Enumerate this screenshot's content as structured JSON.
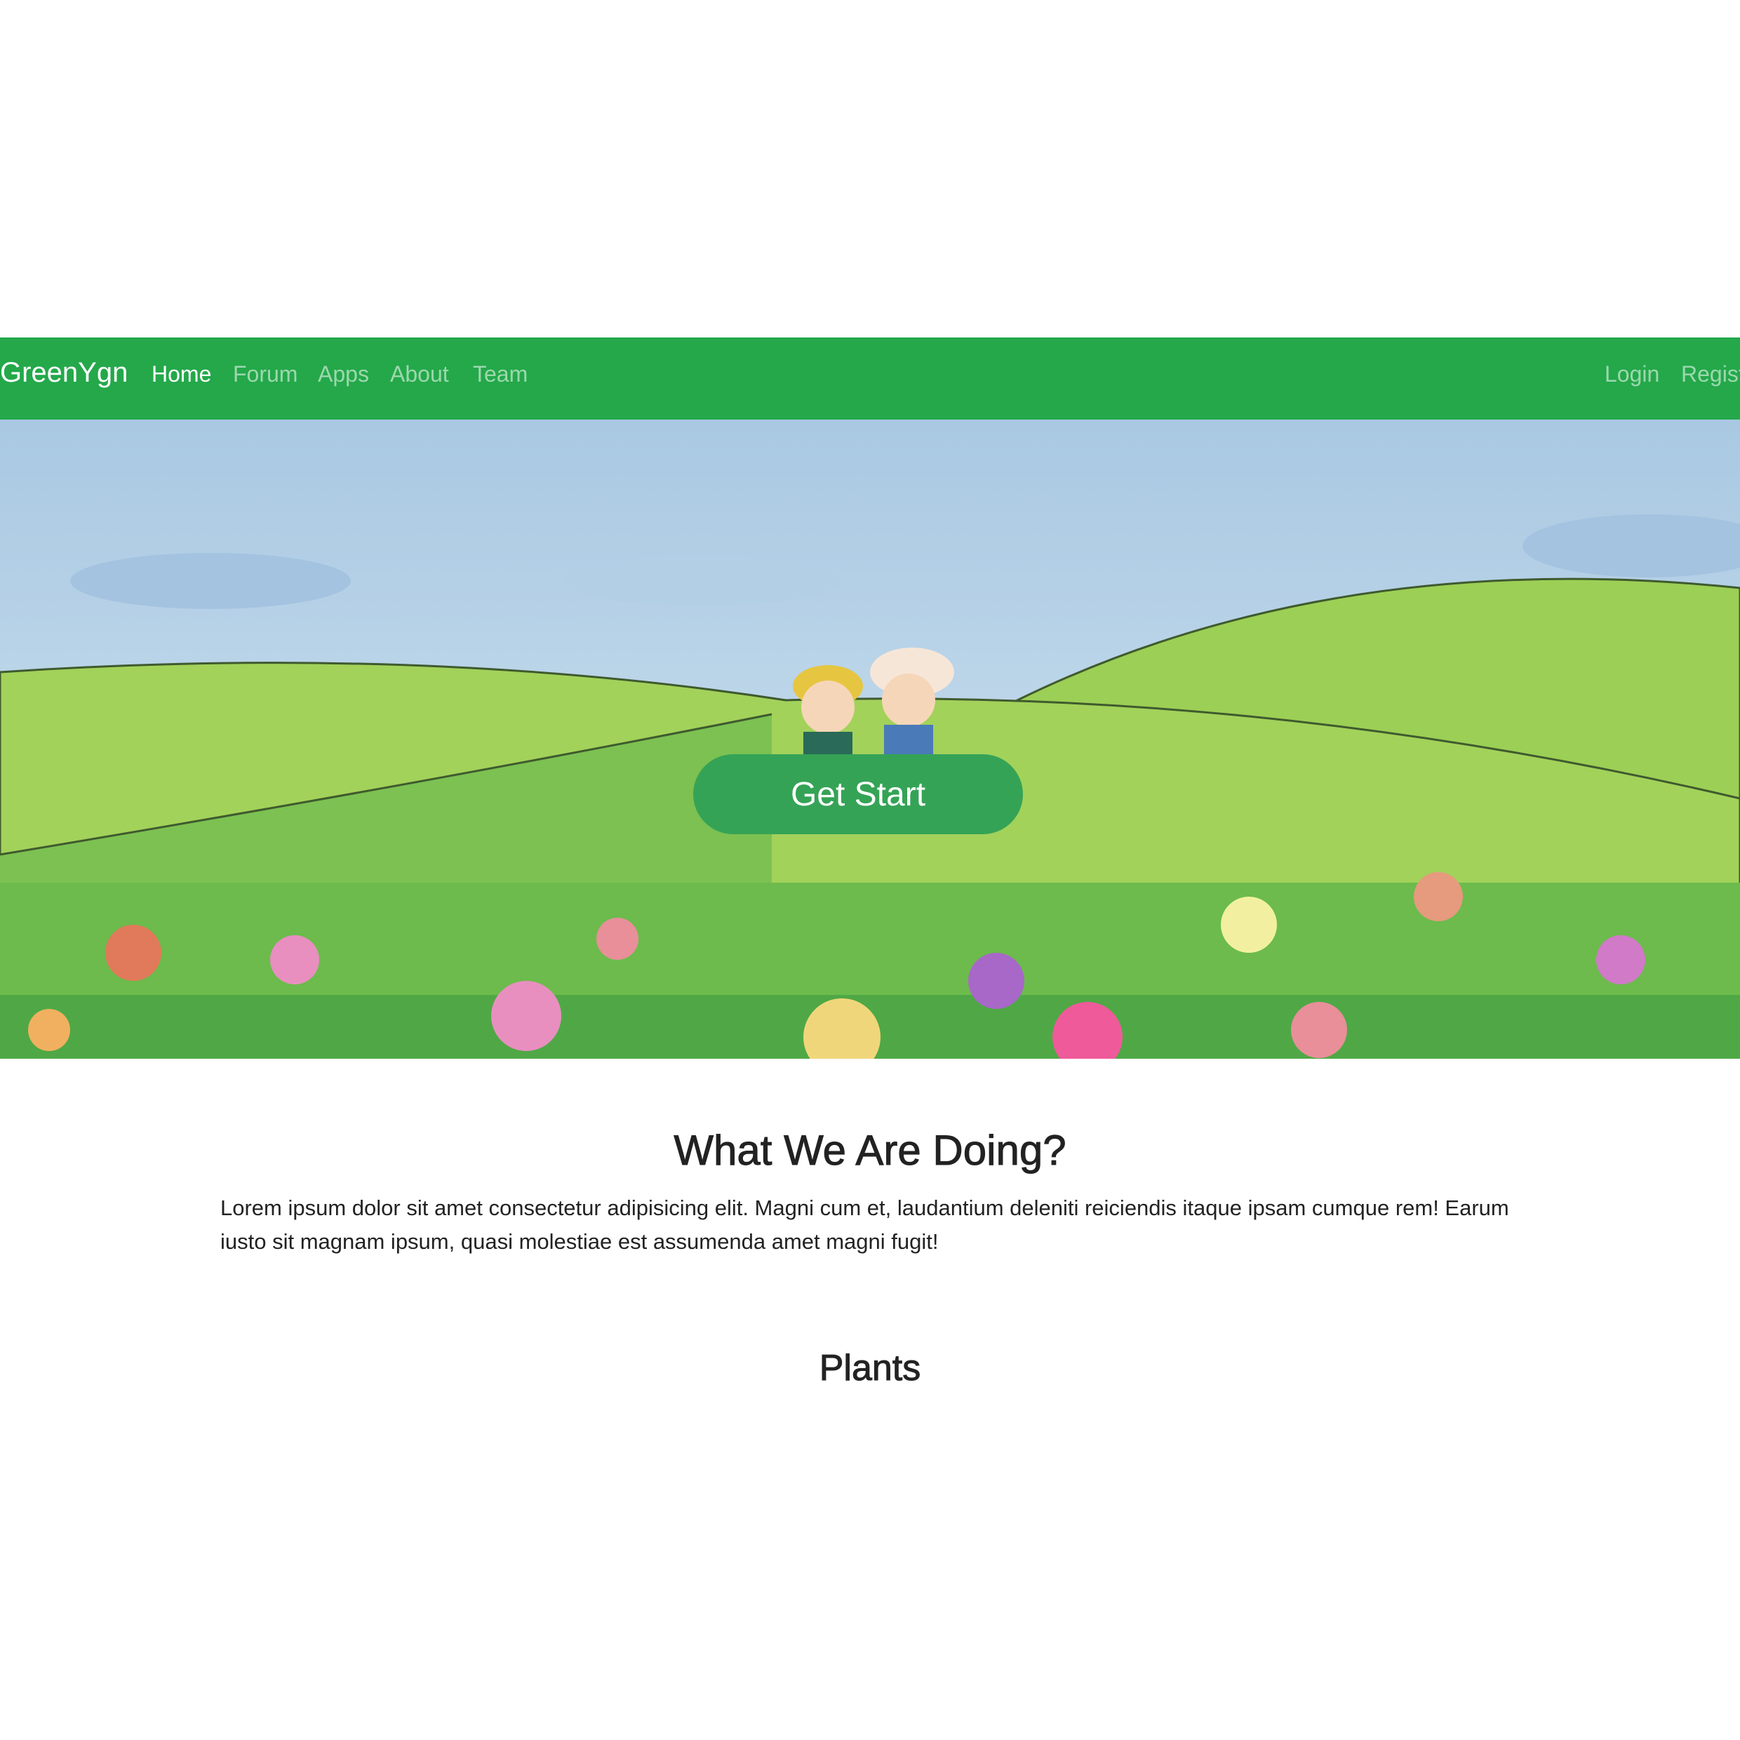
{
  "navbar": {
    "brand": "GreenYgn",
    "links": [
      "Home",
      "Forum",
      "Apps",
      "About",
      "Team"
    ],
    "active": "Home",
    "right_links": [
      "Login",
      "Register"
    ],
    "color": "#24a84a"
  },
  "hero": {
    "button_label": "Get Start",
    "button_color": "#35a356"
  },
  "section": {
    "heading": "What We Are Doing?",
    "body": "Lorem ipsum dolor sit amet consectetur adipisicing elit. Magni cum et, laudantium deleniti reiciendis itaque ipsam cumque rem! Earum iusto sit magnam ipsum, quasi molestiae est assumenda amet magni fugit!"
  },
  "plants": {
    "heading": "Plants"
  }
}
